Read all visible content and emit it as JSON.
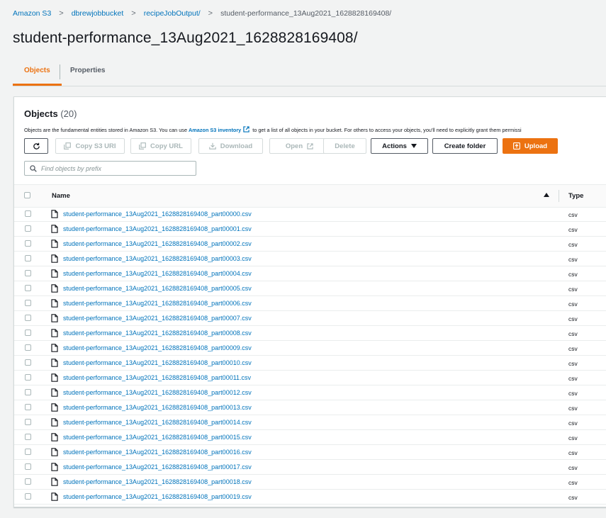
{
  "breadcrumb": {
    "items": [
      "Amazon S3",
      "dbrewjobbucket",
      "recipeJobOutput/"
    ],
    "current": "student-performance_13Aug2021_1628828169408/",
    "separator": ">"
  },
  "page_title": "student-performance_13Aug2021_1628828169408/",
  "tabs": [
    {
      "label": "Objects",
      "active": true
    },
    {
      "label": "Properties",
      "active": false
    }
  ],
  "objects_panel": {
    "title": "Objects",
    "count": "(20)",
    "description_before": "Objects are the fundamental entities stored in Amazon S3. You can use ",
    "description_link": "Amazon S3 inventory",
    "description_after": " to get a list of all objects in your bucket. For others to access your objects, you'll need to explicitly grant them permissi",
    "toolbar": {
      "refresh_icon": "refresh-icon",
      "copy_s3_uri": "Copy S3 URI",
      "copy_url": "Copy URL",
      "download": "Download",
      "open": "Open",
      "delete": "Delete",
      "actions": "Actions",
      "create_folder": "Create folder",
      "upload": "Upload"
    },
    "search": {
      "placeholder": "Find objects by prefix",
      "value": ""
    },
    "table": {
      "columns": [
        "Name",
        "Type"
      ],
      "sort": "Name ascending",
      "rows": [
        {
          "name": "student-performance_13Aug2021_1628828169408_part00000.csv",
          "type": "csv"
        },
        {
          "name": "student-performance_13Aug2021_1628828169408_part00001.csv",
          "type": "csv"
        },
        {
          "name": "student-performance_13Aug2021_1628828169408_part00002.csv",
          "type": "csv"
        },
        {
          "name": "student-performance_13Aug2021_1628828169408_part00003.csv",
          "type": "csv"
        },
        {
          "name": "student-performance_13Aug2021_1628828169408_part00004.csv",
          "type": "csv"
        },
        {
          "name": "student-performance_13Aug2021_1628828169408_part00005.csv",
          "type": "csv"
        },
        {
          "name": "student-performance_13Aug2021_1628828169408_part00006.csv",
          "type": "csv"
        },
        {
          "name": "student-performance_13Aug2021_1628828169408_part00007.csv",
          "type": "csv"
        },
        {
          "name": "student-performance_13Aug2021_1628828169408_part00008.csv",
          "type": "csv"
        },
        {
          "name": "student-performance_13Aug2021_1628828169408_part00009.csv",
          "type": "csv"
        },
        {
          "name": "student-performance_13Aug2021_1628828169408_part00010.csv",
          "type": "csv"
        },
        {
          "name": "student-performance_13Aug2021_1628828169408_part00011.csv",
          "type": "csv"
        },
        {
          "name": "student-performance_13Aug2021_1628828169408_part00012.csv",
          "type": "csv"
        },
        {
          "name": "student-performance_13Aug2021_1628828169408_part00013.csv",
          "type": "csv"
        },
        {
          "name": "student-performance_13Aug2021_1628828169408_part00014.csv",
          "type": "csv"
        },
        {
          "name": "student-performance_13Aug2021_1628828169408_part00015.csv",
          "type": "csv"
        },
        {
          "name": "student-performance_13Aug2021_1628828169408_part00016.csv",
          "type": "csv"
        },
        {
          "name": "student-performance_13Aug2021_1628828169408_part00017.csv",
          "type": "csv"
        },
        {
          "name": "student-performance_13Aug2021_1628828169408_part00018.csv",
          "type": "csv"
        },
        {
          "name": "student-performance_13Aug2021_1628828169408_part00019.csv",
          "type": "csv"
        }
      ]
    }
  },
  "colors": {
    "link": "#0073bb",
    "accent": "#ec7211",
    "text": "#16191f",
    "disabled": "#aab7b8",
    "background": "#f2f3f3"
  }
}
